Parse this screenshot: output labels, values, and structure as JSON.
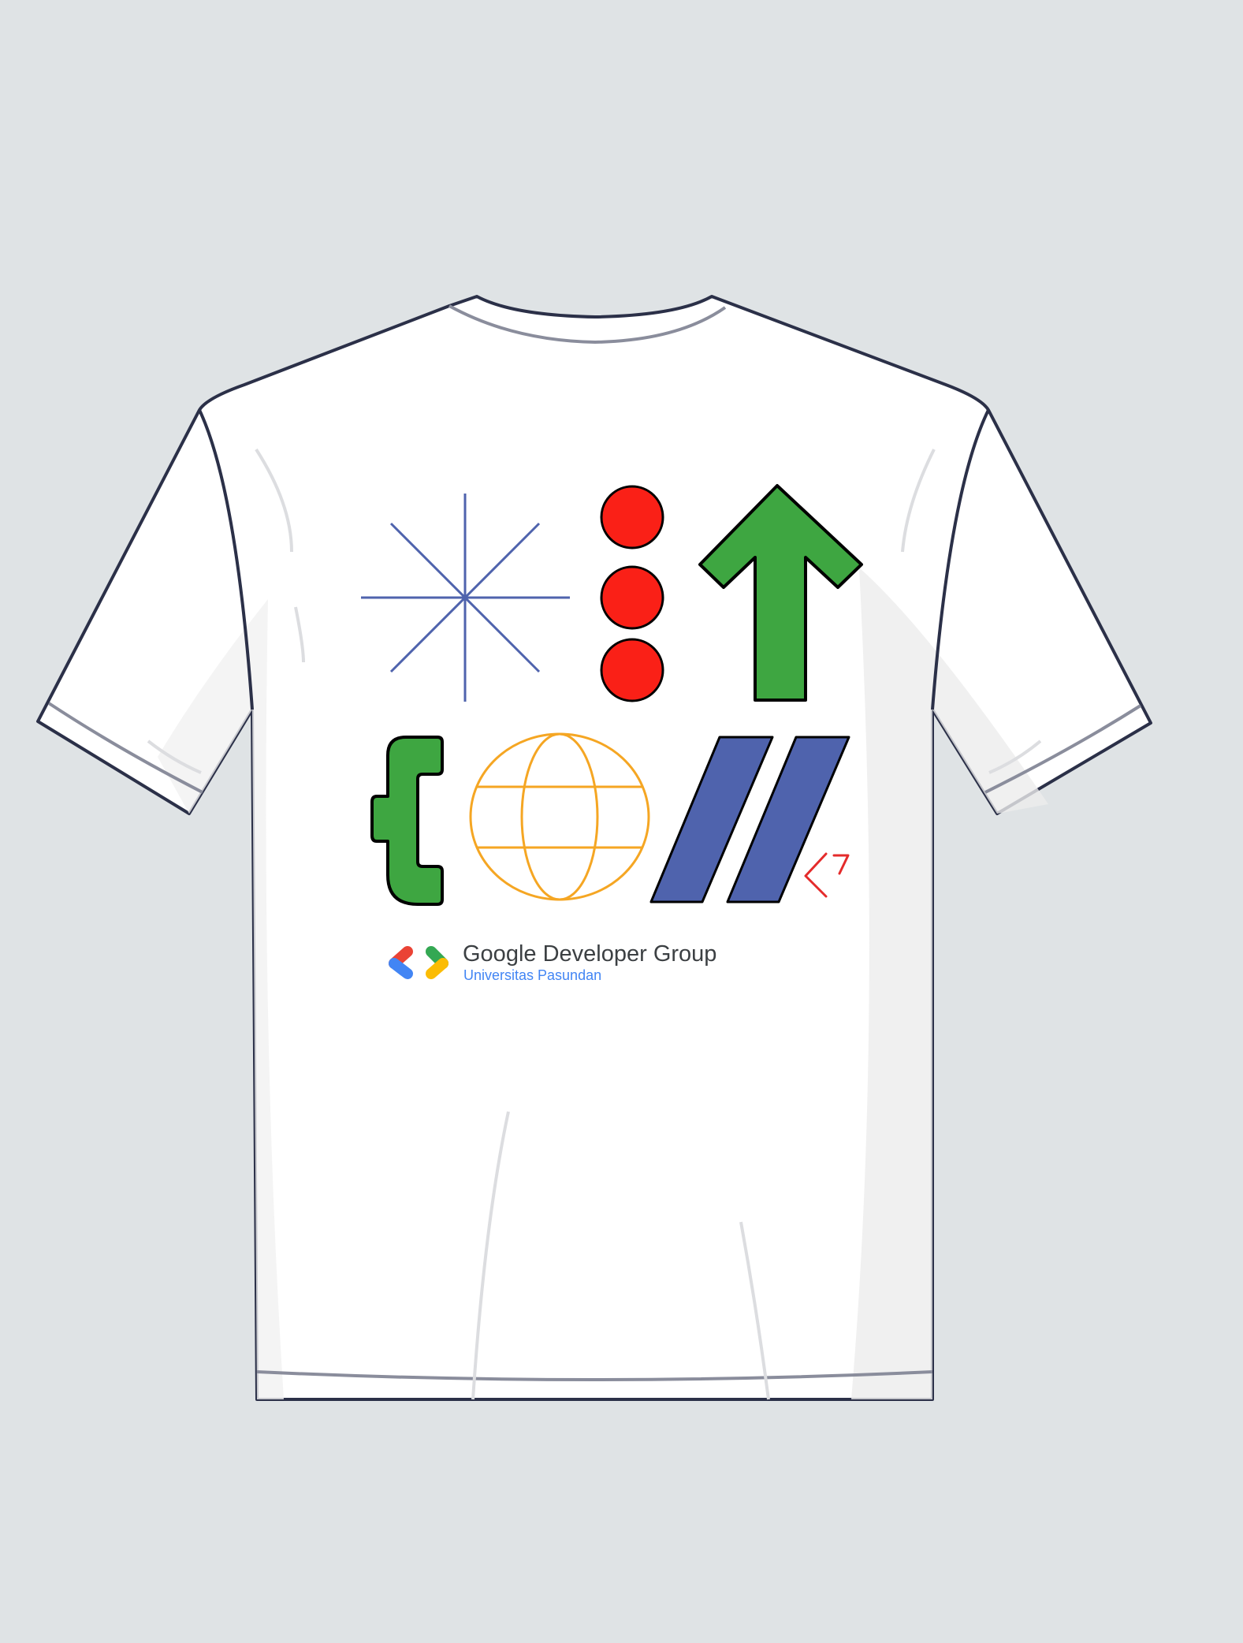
{
  "colors": {
    "background": "#dfe3e5",
    "shirt": "#ffffff",
    "outline": "#2b3048",
    "red": "#ea4335",
    "green": "#3ea641",
    "blue": "#4f63ad",
    "yellow": "#f5a623",
    "dot_red": "#fa2017"
  },
  "icons": [
    "asterisk-burst-icon",
    "three-red-dots-icon",
    "up-arrow-icon",
    "phone-handset-icon",
    "globe-icon",
    "double-slash-icon",
    "less-than-three-heart-icon",
    "gdg-logo-icon"
  ],
  "logo": {
    "title": "Google Developer Group",
    "subtitle": "Universitas Pasundan"
  }
}
